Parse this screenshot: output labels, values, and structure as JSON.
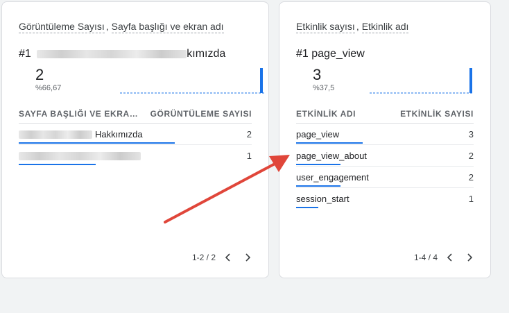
{
  "card1": {
    "title_dim1": "Görüntüleme Sayısı",
    "title_sep": ",",
    "title_dim2": "Sayfa başlığı ve ekran adı",
    "rank": "#1",
    "top_item_visible_suffix": "kımızda",
    "top_value": "2",
    "top_pct": "%66,67",
    "spark_values": [
      0,
      0,
      0,
      0,
      0,
      0,
      0,
      0,
      0,
      0,
      0,
      0,
      0,
      0,
      0,
      0,
      0,
      0,
      0,
      0,
      0,
      0,
      0,
      0,
      0,
      0,
      0,
      0,
      1
    ],
    "headers": {
      "dimension": "SAYFA BAŞLIĞI VE EKRA…",
      "metric": "GÖRÜNTÜLEME SAYISI"
    },
    "rows": [
      {
        "label_visible": "Hakkımızda",
        "value": "2",
        "bar_fraction": 0.67
      },
      {
        "label_visible": "",
        "value": "1",
        "bar_fraction": 0.33
      }
    ],
    "pagination": "1-2 / 2"
  },
  "card2": {
    "title_dim1": "Etkinlik sayısı",
    "title_sep": ",",
    "title_dim2": "Etkinlik adı",
    "top_line": "#1 page_view",
    "top_value": "3",
    "top_pct": "%37,5",
    "spark_values": [
      0,
      0,
      0,
      0,
      0,
      0,
      0,
      0,
      0,
      0,
      0,
      0,
      0,
      0,
      0,
      0,
      0,
      0,
      0,
      0,
      0,
      0,
      0,
      0,
      0,
      0,
      0,
      0,
      1
    ],
    "headers": {
      "dimension": "ETKİNLİK ADI",
      "metric": "ETKİNLİK SAYISI"
    },
    "rows": [
      {
        "label": "page_view",
        "value": "3",
        "bar_fraction": 0.375
      },
      {
        "label": "page_view_about",
        "value": "2",
        "bar_fraction": 0.25
      },
      {
        "label": "user_engagement",
        "value": "2",
        "bar_fraction": 0.25
      },
      {
        "label": "session_start",
        "value": "1",
        "bar_fraction": 0.125
      }
    ],
    "pagination": "1-4 / 4"
  },
  "colors": {
    "accent": "#1a73e8",
    "annotation_arrow": "#e0463a"
  },
  "icons": {
    "prev": "chevron-left-icon",
    "next": "chevron-right-icon"
  }
}
